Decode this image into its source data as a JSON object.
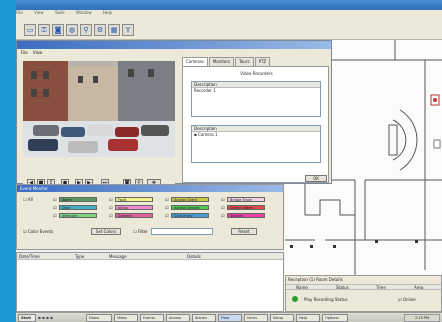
{
  "menu": {
    "items": [
      "File",
      "View",
      "Tools",
      "Window",
      "Help"
    ]
  },
  "toolbar": {
    "icons": [
      "door-icon",
      "key-icon",
      "camera-icon",
      "globe-icon",
      "search-icon",
      "gear-icon",
      "building-icon",
      "antenna-icon"
    ]
  },
  "video_window": {
    "menu": [
      "File",
      "View"
    ],
    "tabs": [
      "Cameras",
      "Monitors",
      "Tours",
      "PTZ"
    ],
    "panel_heading": "Video Recorders",
    "list1_header": "Description",
    "list1_items": [
      "Recorder 1"
    ],
    "list2_header": "Description",
    "list2_items": [
      "Camera 1"
    ],
    "ok_label": "OK"
  },
  "event_panel": {
    "title": "Event Monitor",
    "all_label": "All",
    "swatches": [
      {
        "label": "Alarm",
        "color": "#5a9a5a"
      },
      {
        "label": "Fault",
        "color": "#f2f28a"
      },
      {
        "label": "Access Grant",
        "color": "#c8c846"
      },
      {
        "label": "Bridge Trace",
        "color": "#f2d0e6"
      },
      {
        "label": "Door",
        "color": "#3fb0c8"
      },
      {
        "label": "Intrus",
        "color": "#f08ad0"
      },
      {
        "label": "Access Denied",
        "color": "#4ec84e"
      },
      {
        "label": "Duress Alarm",
        "color": "#e04a4a"
      },
      {
        "label": "Intercom",
        "color": "#7fd27f"
      },
      {
        "label": "Camera",
        "color": "#e060a0"
      },
      {
        "label": "Card Entry",
        "color": "#4a9ad8"
      },
      {
        "label": "System",
        "color": "#ea40a8"
      }
    ],
    "color_events_label": "Color Events",
    "set_colors_label": "Set Colors",
    "filter_label": "Filter",
    "reset_label": "Reset"
  },
  "log": {
    "columns": [
      "Date/Time",
      "Type",
      "Message",
      "Details"
    ]
  },
  "properties": {
    "title": "Reception (1) Room Details",
    "columns": [
      "Name",
      "Status",
      "Time",
      "Area"
    ],
    "row_text": "Play Recording Status",
    "row_check": "Online"
  },
  "taskbar": {
    "start": "Start",
    "tasks": [
      "Doors",
      "Video",
      "Events",
      "Access",
      "Alarms",
      "Floor",
      "Intrus",
      "Setup",
      "Help",
      "Options"
    ],
    "clock": "2:15 PM"
  }
}
